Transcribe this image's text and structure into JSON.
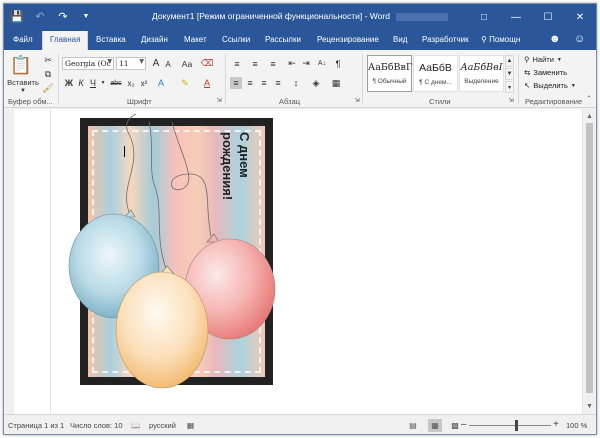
{
  "window": {
    "title": "Документ1 [Режим ограниченной функциональности] - Word"
  },
  "tabs": {
    "file": "Файл",
    "home": "Главная",
    "insert": "Вставка",
    "design": "Дизайн",
    "layout": "Макет",
    "references": "Ссылки",
    "mailings": "Рассылки",
    "review": "Рецензирование",
    "view": "Вид",
    "developer": "Разработчик",
    "tell_me": "Помощн"
  },
  "ribbon": {
    "clipboard": {
      "paste": "Вставить",
      "label": "Буфер обм..."
    },
    "font": {
      "name": "Georgia (Ос",
      "size": "11",
      "label": "Шрифт",
      "bold": "Ж",
      "italic": "К",
      "underline": "Ч",
      "strike": "abc",
      "subscript": "x₂",
      "superscript": "x²",
      "case": "Aa",
      "grow": "A",
      "shrink": "A"
    },
    "paragraph": {
      "label": "Абзац"
    },
    "styles": {
      "label": "Стили",
      "items": [
        {
          "sample": "АаБбВвГ",
          "name": "¶ Обычный"
        },
        {
          "sample": "АаБбВ",
          "name": "¶ С днем..."
        },
        {
          "sample": "АаБбВвІ",
          "name": "Выделение"
        }
      ]
    },
    "editing": {
      "label": "Редактирование",
      "find": "Найти",
      "replace": "Заменить",
      "select": "Выделить"
    }
  },
  "document": {
    "greeting": "С днем\nрождения!"
  },
  "statusbar": {
    "page": "Страница 1 из 1",
    "words": "Число слов: 10",
    "language": "русский",
    "zoom": "100 %"
  },
  "colors": {
    "accent": "#2b579a",
    "balloon_blue": "#a9d3e2",
    "balloon_red": "#f2a3a3",
    "balloon_peach": "#f8d9ad"
  }
}
